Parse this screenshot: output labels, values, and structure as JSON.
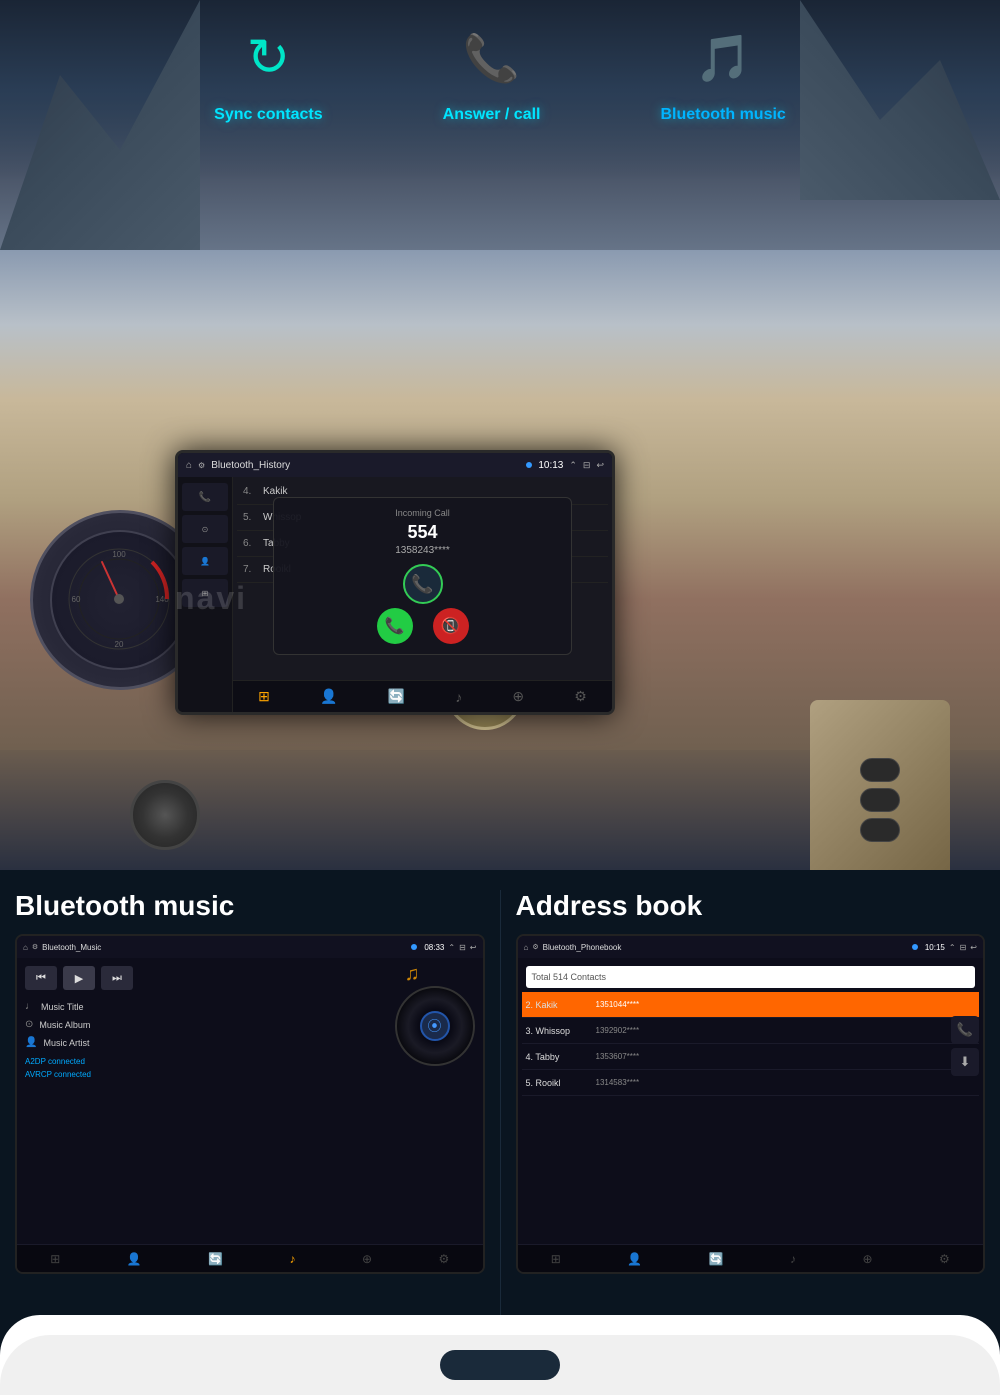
{
  "top": {
    "features": [
      {
        "id": "sync",
        "icon": "↻",
        "label": "Sync contacts",
        "color": "#00e5c8"
      },
      {
        "id": "call",
        "icon": "📞",
        "label": "Answer / call",
        "color": "#00e5c8"
      },
      {
        "id": "music",
        "icon": "🎵",
        "label": "Bluetooth music",
        "color": "#00b4ff"
      }
    ]
  },
  "car_screen": {
    "status_bar": {
      "icon": "⚙",
      "title": "Bluetooth_History",
      "dot_color": "#3399ff",
      "time": "10:13",
      "arrows": "⌃ ⊟ ↩"
    },
    "contacts": [
      {
        "num": "4.",
        "name": "Kakik"
      },
      {
        "num": "5.",
        "name": "Whissop"
      },
      {
        "num": "6.",
        "name": "Tabby"
      },
      {
        "num": "7.",
        "name": "Rooikl"
      }
    ],
    "incoming_call": {
      "label": "Incoming Call",
      "number": "554",
      "caller_id": "1358243****"
    },
    "bottom_nav": [
      "⊞",
      "👤",
      "🔄",
      "♪",
      "⊕",
      "⚙"
    ]
  },
  "bluetooth_music": {
    "title": "Bluetooth music",
    "status_bar": {
      "icon": "⌂",
      "title": "Bluetooth_Music",
      "time": "08:33"
    },
    "controls": {
      "prev": "⏮",
      "play": "▶",
      "next": "⏭"
    },
    "track": {
      "title_icon": "♩",
      "title": "Music Title",
      "album_icon": "⊙",
      "album": "Music Album",
      "artist_icon": "👤",
      "artist": "Music Artist"
    },
    "connection": {
      "a2dp": "A2DP connected",
      "avrcp": "AVRCP connected"
    },
    "bottom_nav": [
      "⊞",
      "👤",
      "🔄",
      "♪",
      "⊕",
      "⚙"
    ]
  },
  "address_book": {
    "title": "Address book",
    "status_bar": {
      "icon": "⌂",
      "title": "Bluetooth_Phonebook",
      "time": "10:15"
    },
    "total_contacts": "Total 514 Contacts",
    "contacts": [
      {
        "num": "2.",
        "name": "Kakik",
        "number": "1351044****",
        "selected": true
      },
      {
        "num": "3.",
        "name": "Whissop",
        "number": "1392902****",
        "selected": false
      },
      {
        "num": "4.",
        "name": "Tabby",
        "number": "1353607****",
        "selected": false
      },
      {
        "num": "5.",
        "name": "Rooikl",
        "number": "1314583****",
        "selected": false
      }
    ],
    "buttons": {
      "call": "📞",
      "download": "⬇"
    },
    "bottom_nav": [
      "⊞",
      "👤",
      "🔄",
      "♪",
      "⊕",
      "⚙"
    ]
  }
}
